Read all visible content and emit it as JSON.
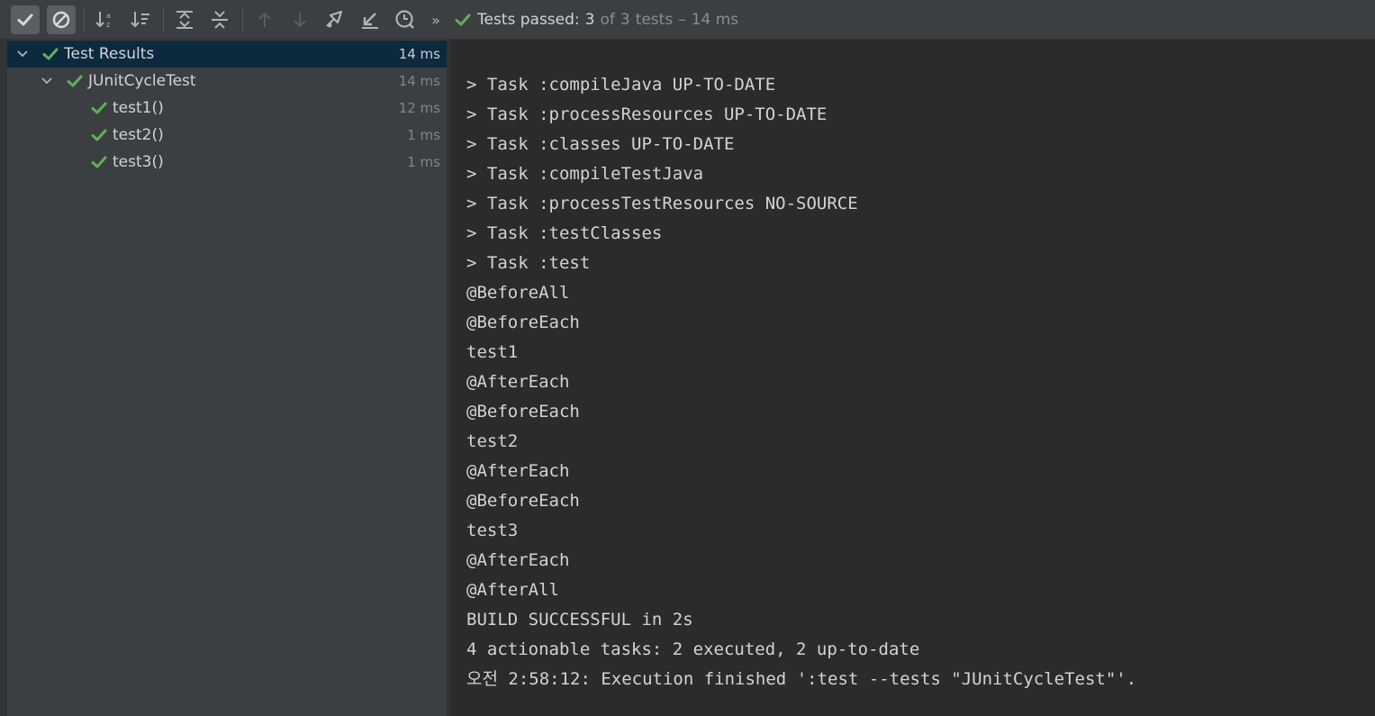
{
  "toolbar": {
    "buttons": [
      {
        "name": "show-passed-button",
        "icon": "check-icon"
      },
      {
        "name": "show-ignored-button",
        "icon": "ignored-circle-icon"
      },
      {
        "name": "sort-alphabetically-button",
        "icon": "sort-alpha-icon"
      },
      {
        "name": "sort-by-duration-button",
        "icon": "sort-duration-icon"
      },
      {
        "name": "expand-all-button",
        "icon": "expand-all-icon"
      },
      {
        "name": "collapse-all-button",
        "icon": "collapse-all-icon"
      },
      {
        "name": "previous-test-button",
        "icon": "arrow-up-icon"
      },
      {
        "name": "next-test-button",
        "icon": "arrow-down-icon"
      },
      {
        "name": "rerun-button",
        "icon": "rerun-icon"
      },
      {
        "name": "import-tests-button",
        "icon": "import-icon"
      },
      {
        "name": "history-button",
        "icon": "history-clock-icon"
      },
      {
        "name": "more-button",
        "icon": "double-chevron-right-icon"
      }
    ],
    "more_label": "»"
  },
  "status": {
    "prefix": "Tests passed:",
    "passed_count": "3",
    "of": "of",
    "total": "3",
    "tests": "tests",
    "dash": "–",
    "duration": "14 ms",
    "icon": "check-icon",
    "color": "#5fb157"
  },
  "tree": {
    "root": {
      "label": "Test Results",
      "time": "14 ms"
    },
    "suite": {
      "label": "JUnitCycleTest",
      "time": "14 ms"
    },
    "tests": [
      {
        "label": "test1()",
        "time": "12 ms"
      },
      {
        "label": "test2()",
        "time": "1 ms"
      },
      {
        "label": "test3()",
        "time": "1 ms"
      }
    ]
  },
  "console": {
    "lines": [
      "> Task :compileJava UP-TO-DATE",
      "> Task :processResources UP-TO-DATE",
      "> Task :classes UP-TO-DATE",
      "> Task :compileTestJava",
      "> Task :processTestResources NO-SOURCE",
      "> Task :testClasses",
      "> Task :test",
      "@BeforeAll",
      "@BeforeEach",
      "test1",
      "@AfterEach",
      "@BeforeEach",
      "test2",
      "@AfterEach",
      "@BeforeEach",
      "test3",
      "@AfterEach",
      "@AfterAll",
      "BUILD SUCCESSFUL in 2s",
      "4 actionable tasks: 2 executed, 2 up-to-date",
      "오전 2:58:12: Execution finished ':test --tests \"JUnitCycleTest\"'."
    ]
  }
}
